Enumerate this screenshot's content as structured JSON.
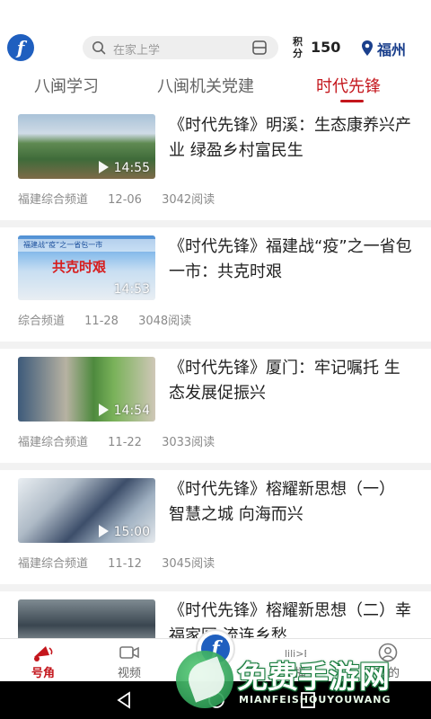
{
  "header": {
    "logo_letter": "f",
    "search_placeholder": "在家上学",
    "points_label": "积分",
    "points_value": "150",
    "city": "福州"
  },
  "tabs": [
    {
      "label": "八闽学习",
      "active": false
    },
    {
      "label": "八闽机关党建",
      "active": false
    },
    {
      "label": "时代先锋",
      "active": true
    }
  ],
  "accent_color": "#c4161c",
  "articles": [
    {
      "title": "《时代先锋》明溪：生态康养兴产业 绿盈乡村富民生",
      "duration": "14:55",
      "source": "福建综合频道",
      "date": "12-06",
      "reads": "3042阅读",
      "thumb_text": "",
      "thumb_caption": ""
    },
    {
      "title": "《时代先锋》福建战“疫”之一省包一市：共克时艰",
      "duration": "14:53",
      "source": "综合频道",
      "date": "11-28",
      "reads": "3048阅读",
      "thumb_text": "共克时艰",
      "thumb_caption": "福建战“疫”之一省包一市"
    },
    {
      "title": "《时代先锋》厦门：牢记嘱托 生态发展促振兴",
      "duration": "14:54",
      "source": "福建综合频道",
      "date": "11-22",
      "reads": "3033阅读",
      "thumb_text": "",
      "thumb_caption": ""
    },
    {
      "title": "《时代先锋》榕耀新思想（一） 智慧之城 向海而兴",
      "duration": "15:00",
      "source": "福建综合频道",
      "date": "11-12",
      "reads": "3045阅读",
      "thumb_text": "",
      "thumb_caption": ""
    },
    {
      "title": "《时代先锋》榕耀新思想（二）幸福家园 流连乡愁",
      "duration": "",
      "source": "",
      "date": "",
      "reads": "",
      "thumb_text": "",
      "thumb_caption": ""
    }
  ],
  "bottom_nav": [
    {
      "label": "号角",
      "icon": "horn-icon",
      "active": true
    },
    {
      "label": "视频",
      "icon": "video-icon",
      "active": false
    },
    {
      "label": "TV",
      "icon": "tv-icon",
      "active": false
    },
    {
      "label": "直播",
      "icon": "live-icon",
      "active": false
    },
    {
      "label": "我的",
      "icon": "user-icon",
      "active": false
    }
  ],
  "watermark": {
    "cn": "免费手游网",
    "en": "MIANFEISHOUYOUWANG"
  }
}
